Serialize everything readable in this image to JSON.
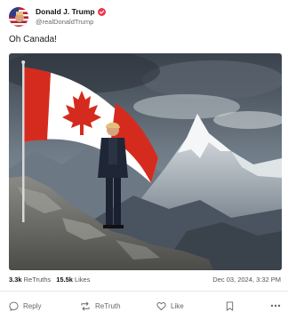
{
  "author": {
    "display_name": "Donald J. Trump",
    "handle": "@realDonaldTrump",
    "avatar_icon": "flag-avatar-icon",
    "verified_icon": "verified-badge-icon",
    "verified_color": "#e8384f"
  },
  "post": {
    "text": "Oh Canada!",
    "image": {
      "description_icon": "canadian-flag-mountain-image",
      "flag_red": "#d52b1e"
    }
  },
  "stats": {
    "retruths_count": "3.3k",
    "retruths_label": "ReTruths",
    "likes_count": "15.5k",
    "likes_label": "Likes",
    "timestamp": "Dec 03, 2024, 3:32 PM"
  },
  "actions": {
    "reply_label": "Reply",
    "retruth_label": "ReTruth",
    "like_label": "Like",
    "icons": [
      "reply-icon",
      "retruth-icon",
      "like-icon",
      "bookmark-icon",
      "more-icon"
    ]
  }
}
